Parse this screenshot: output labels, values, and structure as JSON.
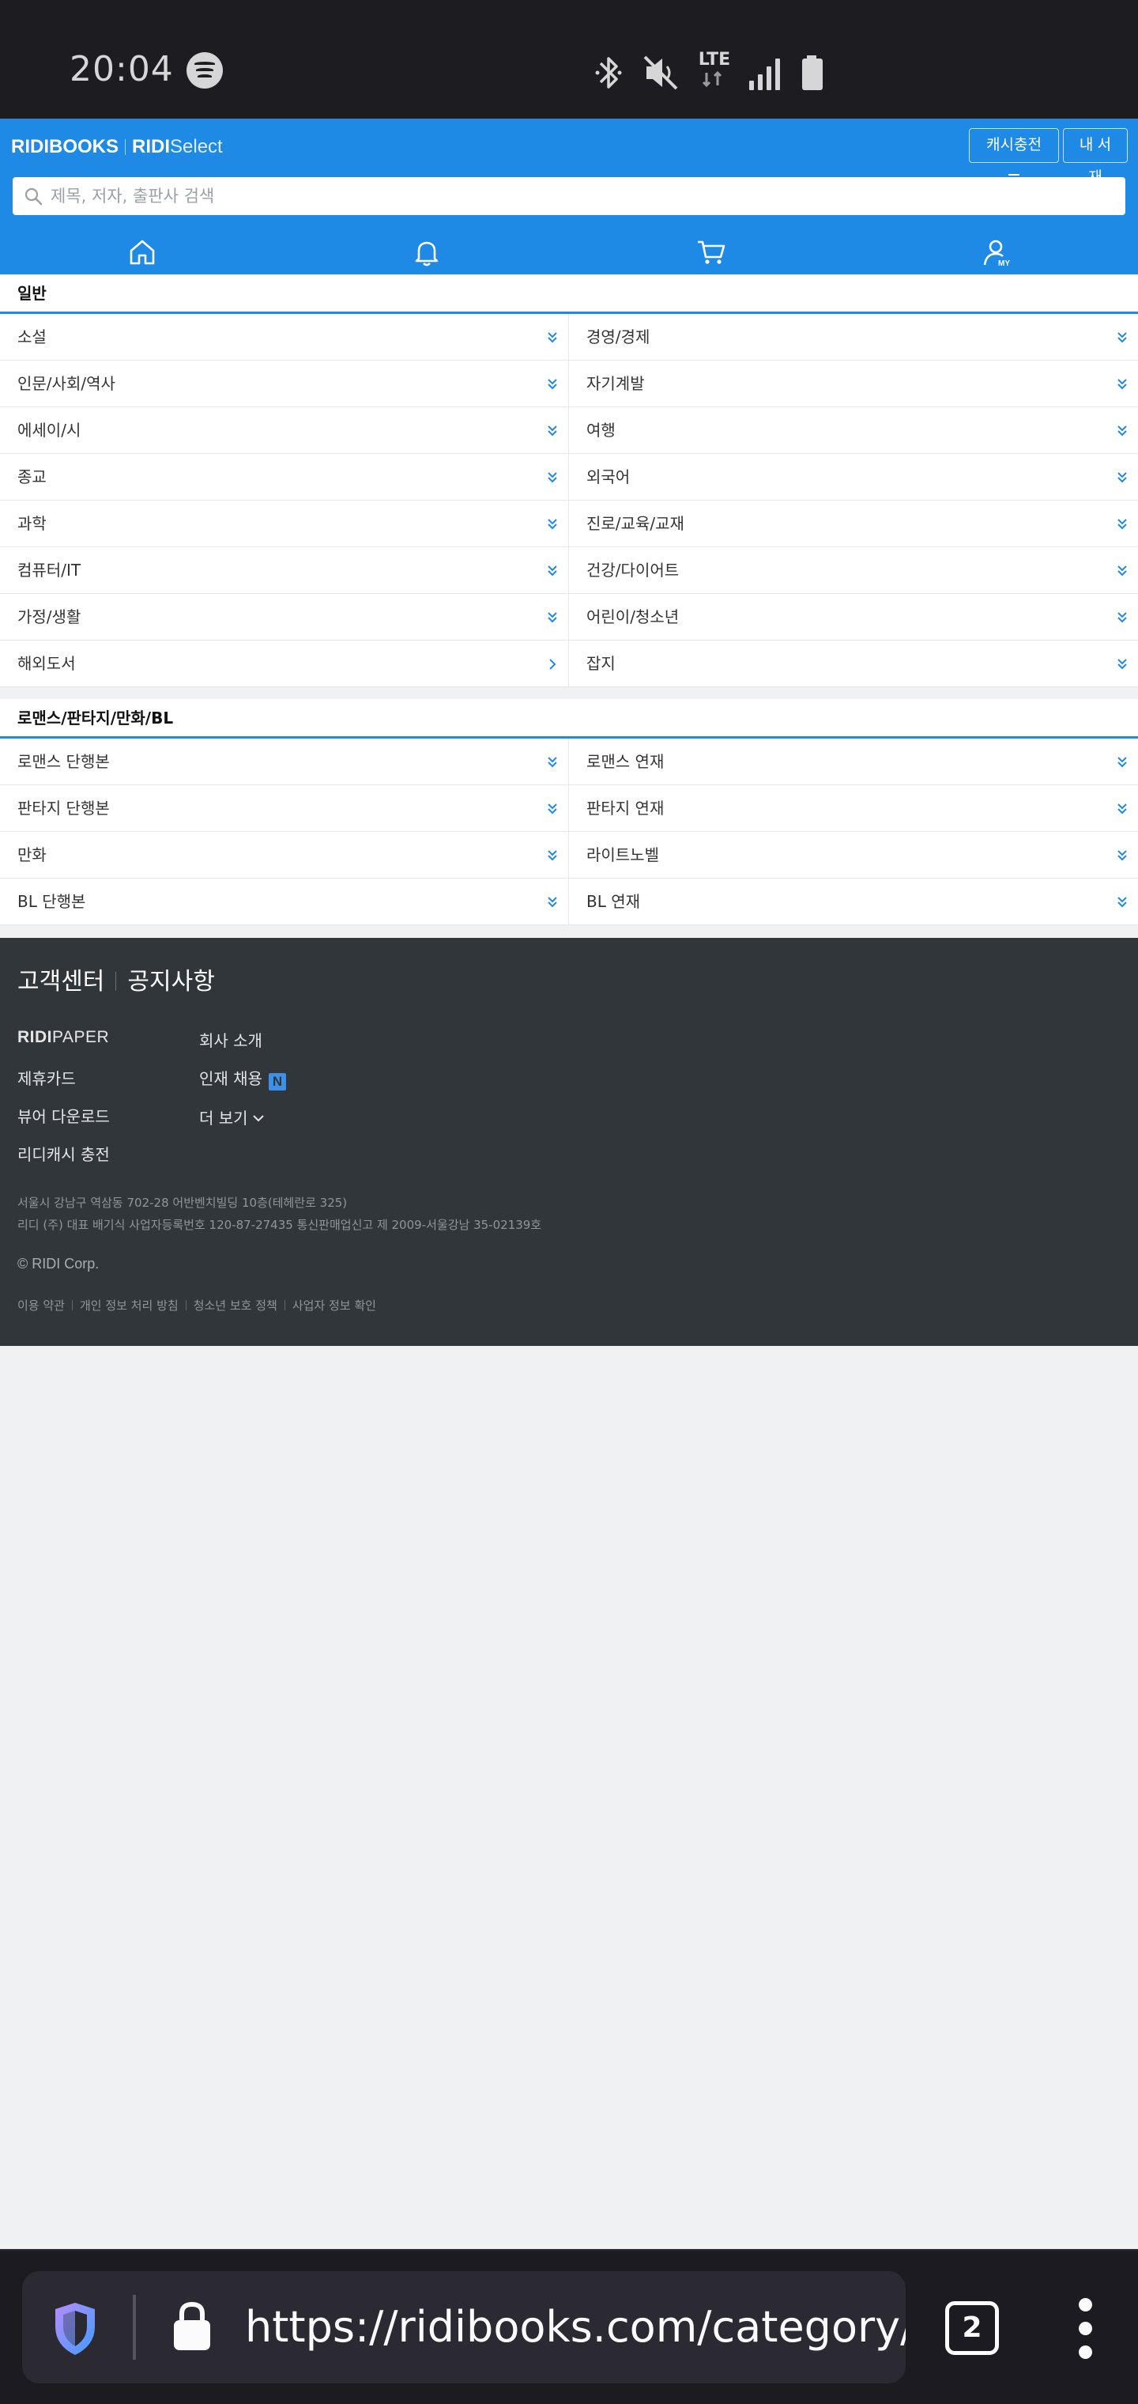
{
  "status_bar": {
    "time": "20:04",
    "network": "LTE",
    "icons": [
      "spotify-icon",
      "bluetooth-icon",
      "mute-icon",
      "lte-icon",
      "signal-icon",
      "battery-icon"
    ]
  },
  "header": {
    "brand_ridibooks": "RIDIBOOKS",
    "brand_ridi": "RIDI",
    "brand_select": "Select",
    "cash_button": "캐시충전",
    "library_button": "내 서재",
    "search_placeholder": "제목, 저자, 출판사 검색",
    "accent_color": "#1e8ae6"
  },
  "sections": [
    {
      "title": "일반",
      "items": [
        {
          "label": "소설"
        },
        {
          "label": "경영/경제"
        },
        {
          "label": "인문/사회/역사"
        },
        {
          "label": "자기계발"
        },
        {
          "label": "에세이/시"
        },
        {
          "label": "여행"
        },
        {
          "label": "종교"
        },
        {
          "label": "외국어"
        },
        {
          "label": "과학"
        },
        {
          "label": "진로/교육/교재"
        },
        {
          "label": "컴퓨터/IT"
        },
        {
          "label": "건강/다이어트"
        },
        {
          "label": "가정/생활"
        },
        {
          "label": "어린이/청소년"
        },
        {
          "label": "해외도서"
        },
        {
          "label": "잡지"
        }
      ]
    },
    {
      "title": "로맨스/판타지/만화/BL",
      "items": [
        {
          "label": "로맨스 단행본"
        },
        {
          "label": "로맨스 연재"
        },
        {
          "label": "판타지 단행본"
        },
        {
          "label": "판타지 연재"
        },
        {
          "label": "만화"
        },
        {
          "label": "라이트노벨"
        },
        {
          "label": "BL 단행본"
        },
        {
          "label": "BL 연재"
        }
      ]
    }
  ],
  "footer": {
    "customer_center": "고객센터",
    "notices": "공지사항",
    "ridipaper_ridi": "RIDI",
    "ridipaper_paper": "PAPER",
    "partner_card": "제휴카드",
    "viewer_download": "뷰어 다운로드",
    "ridi_cash": "리디캐시 충전",
    "company_intro": "회사 소개",
    "recruit": "인재 채용",
    "recruit_badge": "N",
    "more": "더 보기",
    "address_line1": "서울시 강남구 역삼동 702-28 어반벤치빌딩 10층(테헤란로 325)",
    "address_line2": "리디 (주) 대표 배기식 사업자등록번호 120-87-27435 통신판매업신고 제 2009-서울강남 35-02139호",
    "copyright": "© RIDI Corp.",
    "policies": [
      "이용 약관",
      "개인 정보 처리 방침",
      "청소년 보호 정책",
      "사업자 정보 확인"
    ]
  },
  "browser": {
    "url": "https://ridibooks.com/category/list",
    "tab_count": "2"
  }
}
